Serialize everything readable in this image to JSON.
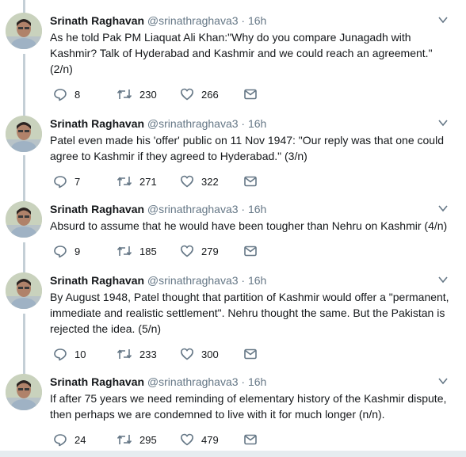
{
  "tweets": [
    {
      "author_name": "Srinath Raghavan",
      "handle_time": "@srinathraghava3 · 16h",
      "text": "As he told Pak PM Liaquat Ali Khan:\"Why do you compare Junagadh with Kashmir? Talk of Hyderabad and Kashmir and we could reach an agreement.\" (2/n)",
      "replies": "8",
      "retweets": "230",
      "likes": "266"
    },
    {
      "author_name": "Srinath Raghavan",
      "handle_time": "@srinathraghava3 · 16h",
      "text": "Patel even made his 'offer' public on 11 Nov 1947: \"Our reply was that one could agree to Kashmir if they agreed to Hyderabad.\" (3/n)",
      "replies": "7",
      "retweets": "271",
      "likes": "322"
    },
    {
      "author_name": "Srinath Raghavan",
      "handle_time": "@srinathraghava3 · 16h",
      "text": "Absurd to assume that he would have been tougher than Nehru on Kashmir (4/n)",
      "replies": "9",
      "retweets": "185",
      "likes": "279"
    },
    {
      "author_name": "Srinath Raghavan",
      "handle_time": "@srinathraghava3 · 16h",
      "text": "By August 1948, Patel thought that partition of Kashmir would offer a \"permanent, immediate and realistic settlement\". Nehru thought the same. But the Pakistan is rejected the idea. (5/n)",
      "replies": "10",
      "retweets": "233",
      "likes": "300"
    },
    {
      "author_name": "Srinath Raghavan",
      "handle_time": "@srinathraghava3 · 16h",
      "text": "If after 75 years we need reminding of elementary history of the Kashmir dispute, then perhaps we are condemned to live with it for much longer (n/n).",
      "replies": "24",
      "retweets": "295",
      "likes": "479"
    }
  ]
}
